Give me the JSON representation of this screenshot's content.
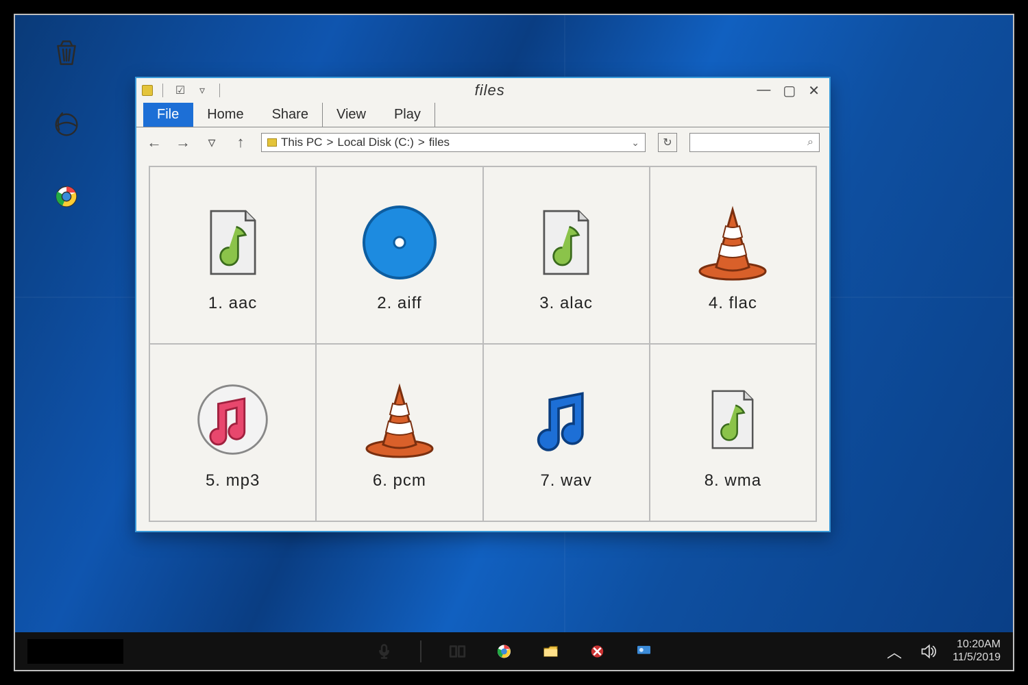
{
  "window": {
    "title": "files",
    "controls": {
      "minimize": "—",
      "maximize": "▢",
      "close": "✕"
    }
  },
  "ribbon": {
    "tabs": [
      "File",
      "Home",
      "Share",
      "View",
      "Play"
    ],
    "active": "File"
  },
  "breadcrumb": {
    "segments": [
      "This PC",
      "Local Disk (C:)",
      "files"
    ]
  },
  "search": {
    "placeholder": ""
  },
  "files": [
    {
      "name": "1. aac",
      "icon": "music-file"
    },
    {
      "name": "2. aiff",
      "icon": "disc"
    },
    {
      "name": "3. alac",
      "icon": "music-file"
    },
    {
      "name": "4. flac",
      "icon": "vlc-cone"
    },
    {
      "name": "5. mp3",
      "icon": "itunes"
    },
    {
      "name": "6. pcm",
      "icon": "vlc-cone"
    },
    {
      "name": "7. wav",
      "icon": "music-note"
    },
    {
      "name": "8. wma",
      "icon": "music-file"
    }
  ],
  "desktop_icons": [
    "recycle-bin",
    "internet-explorer",
    "chrome"
  ],
  "taskbar": {
    "center_icons": [
      "mic",
      "task-view",
      "chrome",
      "file-explorer",
      "snip",
      "cortana"
    ],
    "tray_icons": [
      "chevron-up",
      "volume"
    ],
    "clock": {
      "time": "10:20AM",
      "date": "11/5/2019"
    }
  },
  "colors": {
    "accent": "#1d6fd6",
    "window_border": "#3a9ad9",
    "folder": "#e4c43a",
    "cone": "#d9602a",
    "disc": "#1d8be0"
  }
}
